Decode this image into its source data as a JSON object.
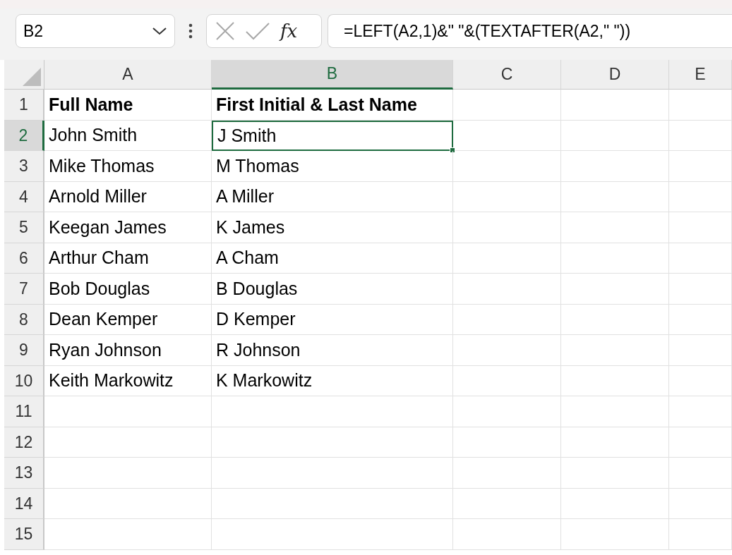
{
  "formula_bar": {
    "name_box": "B2",
    "cancel_disabled": true,
    "enter_disabled": true,
    "function_label": "fx",
    "formula": "=LEFT(A2,1)&\" \"&(TEXTAFTER(A2,\" \"))"
  },
  "columns": [
    {
      "label": "A",
      "selected": false
    },
    {
      "label": "B",
      "selected": true
    },
    {
      "label": "C",
      "selected": false
    },
    {
      "label": "D",
      "selected": false
    },
    {
      "label": "E",
      "selected": false
    }
  ],
  "rows": [
    {
      "number": "1",
      "selected": false,
      "cells": [
        {
          "text": "Full Name",
          "bold": true,
          "selected": false
        },
        {
          "text": "First Initial & Last Name",
          "bold": true,
          "selected": false
        }
      ]
    },
    {
      "number": "2",
      "selected": true,
      "cells": [
        {
          "text": "John Smith",
          "bold": false,
          "selected": false
        },
        {
          "text": "J Smith",
          "bold": false,
          "selected": true
        }
      ]
    },
    {
      "number": "3",
      "selected": false,
      "cells": [
        {
          "text": "Mike Thomas",
          "bold": false,
          "selected": false
        },
        {
          "text": "M Thomas",
          "bold": false,
          "selected": false
        }
      ]
    },
    {
      "number": "4",
      "selected": false,
      "cells": [
        {
          "text": "Arnold Miller",
          "bold": false,
          "selected": false
        },
        {
          "text": "A Miller",
          "bold": false,
          "selected": false
        }
      ]
    },
    {
      "number": "5",
      "selected": false,
      "cells": [
        {
          "text": "Keegan James",
          "bold": false,
          "selected": false
        },
        {
          "text": "K James",
          "bold": false,
          "selected": false
        }
      ]
    },
    {
      "number": "6",
      "selected": false,
      "cells": [
        {
          "text": "Arthur Cham",
          "bold": false,
          "selected": false
        },
        {
          "text": "A Cham",
          "bold": false,
          "selected": false
        }
      ]
    },
    {
      "number": "7",
      "selected": false,
      "cells": [
        {
          "text": "Bob Douglas",
          "bold": false,
          "selected": false
        },
        {
          "text": "B Douglas",
          "bold": false,
          "selected": false
        }
      ]
    },
    {
      "number": "8",
      "selected": false,
      "cells": [
        {
          "text": "Dean Kemper",
          "bold": false,
          "selected": false
        },
        {
          "text": "D Kemper",
          "bold": false,
          "selected": false
        }
      ]
    },
    {
      "number": "9",
      "selected": false,
      "cells": [
        {
          "text": "Ryan Johnson",
          "bold": false,
          "selected": false
        },
        {
          "text": "R Johnson",
          "bold": false,
          "selected": false
        }
      ]
    },
    {
      "number": "10",
      "selected": false,
      "cells": [
        {
          "text": "Keith Markowitz",
          "bold": false,
          "selected": false
        },
        {
          "text": "K Markowitz",
          "bold": false,
          "selected": false
        }
      ]
    },
    {
      "number": "11",
      "selected": false
    },
    {
      "number": "12",
      "selected": false
    },
    {
      "number": "13",
      "selected": false
    },
    {
      "number": "14",
      "selected": false
    },
    {
      "number": "15",
      "selected": false
    }
  ]
}
